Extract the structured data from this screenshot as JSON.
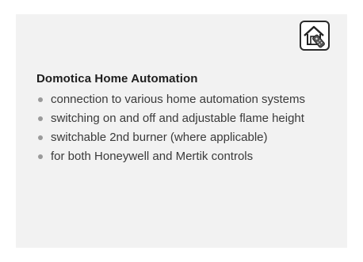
{
  "section": {
    "icon": "home-automation-icon",
    "title": "Domotica Home Automation",
    "features": [
      "connection to various home automation systems",
      "switching on and off and adjustable flame height",
      "switchable 2nd burner (where applicable)",
      "for both Honeywell and Mertik controls"
    ]
  }
}
